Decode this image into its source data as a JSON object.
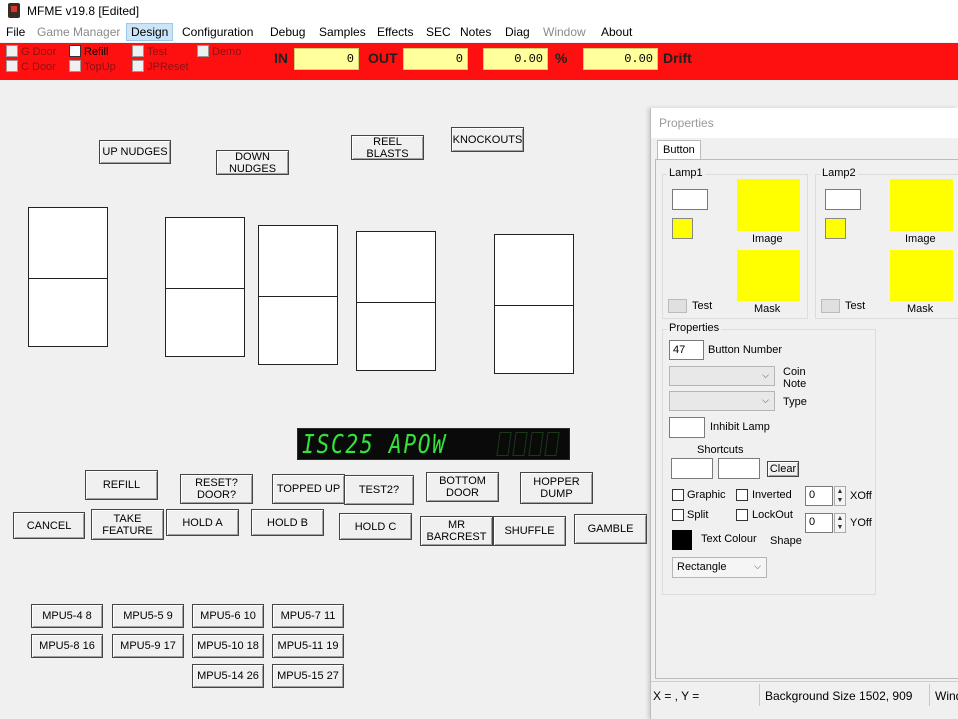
{
  "window": {
    "title": "MFME v19.8 [Edited]"
  },
  "menu": [
    "File",
    "Game Manager",
    "Design",
    "Configuration",
    "Debug",
    "Samples",
    "Effects",
    "SEC",
    "Notes",
    "Diag",
    "Window",
    "About"
  ],
  "menu_disabled": [
    "Game Manager",
    "Window"
  ],
  "menu_active": "Design",
  "toolbar": {
    "checkboxes": [
      "G Door",
      "Refill",
      "Test",
      "Demo",
      "C Door",
      "TopUp",
      "JPReset"
    ],
    "in_label": "IN",
    "in_value": "0",
    "out_label": "OUT",
    "out_value": "0",
    "pct_value": "0.00",
    "pct_label": "%",
    "drift_value": "0.00",
    "drift_label": "Drift"
  },
  "layout_buttons": {
    "up_nudges": "UP NUDGES",
    "down_nudges": "DOWN NUDGES",
    "reel_blasts": "REEL BLASTS",
    "knockouts": "KNOCKOUTS",
    "refill": "REFILL",
    "reset_door": "RESET? DOOR?",
    "topped_up": "TOPPED UP",
    "test2": "TEST2?",
    "bottom_door": "BOTTOM DOOR",
    "hopper_dump": "HOPPER DUMP",
    "cancel": "CANCEL",
    "take_feature": "TAKE FEATURE",
    "hold_a": "HOLD A",
    "hold_b": "HOLD B",
    "hold_c": "HOLD C",
    "mr_barcrest": "MR BARCREST",
    "shuffle": "SHUFFLE",
    "gamble": "GAMBLE"
  },
  "display": {
    "text": "ISC25 APOW"
  },
  "mpu_buttons": [
    "MPU5-4 8",
    "MPU5-5 9",
    "MPU5-6 10",
    "MPU5-7 11",
    "MPU5-8 16",
    "MPU5-9 17",
    "MPU5-10 18",
    "MPU5-11 19",
    "MPU5-14 26",
    "MPU5-15 27"
  ],
  "properties": {
    "title": "Properties",
    "tab": "Button",
    "lamp1": "Lamp1",
    "lamp2": "Lamp2",
    "image": "Image",
    "mask": "Mask",
    "test": "Test",
    "group_label": "Properties",
    "button_number": "47",
    "button_number_label": "Button Number",
    "coin_label": "Coin",
    "note_label": "Note",
    "type_label": "Type",
    "inhibit_lamp": "Inhibit Lamp",
    "shortcuts": "Shortcuts",
    "clear": "Clear",
    "graphic": "Graphic",
    "inverted": "Inverted",
    "split": "Split",
    "lockout": "LockOut",
    "xoff_value": "0",
    "xoff_label": "XOff",
    "yoff_value": "0",
    "yoff_label": "YOff",
    "text_colour": "Text Colour",
    "shape_label": "Shape",
    "shape_value": "Rectangle",
    "lamp_color": "#ffff00",
    "text_color_swatch": "#000000"
  },
  "status": {
    "coords": "X =  , Y =",
    "bg_size": "Background Size 1502, 909",
    "trailing": "Wind"
  }
}
